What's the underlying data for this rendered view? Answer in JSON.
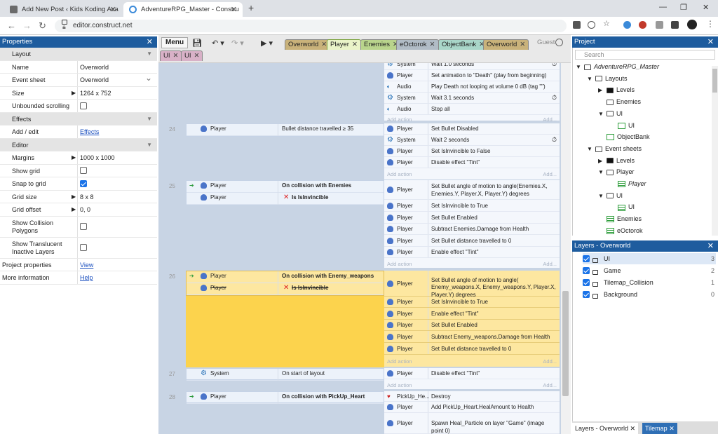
{
  "browser": {
    "tabs": [
      {
        "title": "Add New Post ‹ Kids Koding Aca",
        "active": false
      },
      {
        "title": "AdventureRPG_Master - Constru",
        "active": true
      }
    ],
    "url": "editor.construct.net"
  },
  "properties": {
    "title": "Properties",
    "rows": [
      {
        "type": "section",
        "label": "Layout"
      },
      {
        "type": "text",
        "label": "Name",
        "value": "Overworld"
      },
      {
        "type": "select",
        "label": "Event sheet",
        "value": "Overworld"
      },
      {
        "type": "expand",
        "label": "Size",
        "value": "1264 x 752"
      },
      {
        "type": "check",
        "label": "Unbounded scrolling",
        "checked": false
      },
      {
        "type": "section",
        "label": "Effects"
      },
      {
        "type": "link",
        "label": "Add / edit",
        "value": "Effects"
      },
      {
        "type": "section",
        "label": "Editor"
      },
      {
        "type": "expand",
        "label": "Margins",
        "value": "1000 x 1000"
      },
      {
        "type": "check",
        "label": "Show grid",
        "checked": false
      },
      {
        "type": "check",
        "label": "Snap to grid",
        "checked": true
      },
      {
        "type": "expand",
        "label": "Grid size",
        "value": "8 x 8"
      },
      {
        "type": "expand",
        "label": "Grid offset",
        "value": "0, 0"
      },
      {
        "type": "check2",
        "label": "Show Collision Polygons",
        "checked": false
      },
      {
        "type": "check2",
        "label": "Show Translucent Inactive Layers",
        "checked": false
      },
      {
        "type": "link0",
        "label": "Project properties",
        "value": "View"
      },
      {
        "type": "link0",
        "label": "More information",
        "value": "Help"
      }
    ]
  },
  "toolbar": {
    "menu_label": "Menu",
    "guest_label": "Guest",
    "tabs": [
      {
        "label": "Overworld",
        "color": "#c9b27a"
      },
      {
        "label": "Player",
        "color": "#d8e8a0"
      },
      {
        "label": "Enemies",
        "color": "#b9d48c"
      },
      {
        "label": "eOctorok",
        "color": "#b1bcc6"
      },
      {
        "label": "ObjectBank",
        "color": "#a9d6c9"
      },
      {
        "label": "Overworld",
        "color": "#c9b27a"
      },
      {
        "label": "UI",
        "color": "#d8b1c7"
      },
      {
        "label": "UI",
        "color": "#d8b1c7"
      }
    ]
  },
  "events": {
    "add_action": "Add action",
    "add_short": "Add...",
    "top_block": [
      {
        "obj": "System",
        "icon": "sys",
        "text": "Wait 1.0 seconds"
      },
      {
        "obj": "Player",
        "icon": "pl",
        "text": "Set animation to \"Death\" (play from beginning)"
      },
      {
        "obj": "Audio",
        "icon": "aud",
        "text": "Play Death not looping at volume 0 dB (tag \"\")"
      },
      {
        "obj": "System",
        "icon": "sys",
        "text": "Wait 3.1 seconds"
      },
      {
        "obj": "Audio",
        "icon": "aud",
        "text": "Stop all"
      }
    ],
    "e24": {
      "num": "24",
      "conds": [
        {
          "obj": "Player",
          "text": "Bullet distance travelled ≥ 35"
        }
      ],
      "acts": [
        {
          "obj": "Player",
          "text": "Set  Bullet Disabled"
        },
        {
          "obj": "System",
          "text": "Wait 2 seconds"
        },
        {
          "obj": "Player",
          "text": "Set IsInvincible to False"
        },
        {
          "obj": "Player",
          "text": "Disable effect \"Tint\""
        }
      ]
    },
    "e25": {
      "num": "25",
      "conds": [
        {
          "obj": "Player",
          "text": "On collision with  Enemies"
        },
        {
          "obj": "Player",
          "text": "Is IsInvincible"
        }
      ],
      "acts": [
        {
          "obj": "Player",
          "text": "Set  Bullet angle of motion to angle(Enemies.X, Enemies.Y, Player.X, Player.Y) degrees"
        },
        {
          "obj": "Player",
          "text": "Set IsInvincible to True"
        },
        {
          "obj": "Player",
          "text": "Set  Bullet Enabled"
        },
        {
          "obj": "Player",
          "text": "Subtract Enemies.Damage from Health"
        },
        {
          "obj": "Player",
          "text": "Set  Bullet distance travelled to 0"
        },
        {
          "obj": "Player",
          "text": "Enable effect \"Tint\""
        }
      ]
    },
    "e26": {
      "num": "26",
      "conds": [
        {
          "obj": "Player",
          "text": "On collision with  Enemy_weapons"
        },
        {
          "obj": "Player",
          "text": "Is IsInvincible"
        }
      ],
      "acts": [
        {
          "obj": "Player",
          "text": "Set  Bullet angle of motion to angle( Enemy_weapons.X, Enemy_weapons.Y, Player.X, Player.Y) degrees"
        },
        {
          "obj": "Player",
          "text": "Set IsInvincible to True"
        },
        {
          "obj": "Player",
          "text": "Enable effect \"Tint\""
        },
        {
          "obj": "Player",
          "text": "Set  Bullet Enabled"
        },
        {
          "obj": "Player",
          "text": "Subtract Enemy_weapons.Damage from Health"
        },
        {
          "obj": "Player",
          "text": "Set  Bullet distance travelled to 0"
        }
      ]
    },
    "e27": {
      "num": "27",
      "conds": [
        {
          "obj": "System",
          "text": "On start of layout"
        }
      ],
      "acts": [
        {
          "obj": "Player",
          "text": "Disable effect \"Tint\""
        }
      ]
    },
    "e28": {
      "num": "28",
      "conds": [
        {
          "obj": "Player",
          "text": "On collision with  PickUp_Heart"
        }
      ],
      "acts": [
        {
          "obj": "PickUp_He...",
          "text": "Destroy"
        },
        {
          "obj": "Player",
          "text": "Add PickUp_Heart.HealAmount to Health"
        },
        {
          "obj": "Player",
          "text": "Spawn  Heal_Particle on layer \"Game\" (image point 0)"
        }
      ]
    }
  },
  "project": {
    "title": "Project",
    "search_placeholder": "Search",
    "tree": [
      {
        "d": 0,
        "arrow": "open",
        "icon": "fold",
        "label": "AdventureRPG_Master",
        "italic": true
      },
      {
        "d": 1,
        "arrow": "open",
        "icon": "fold",
        "label": "Layouts"
      },
      {
        "d": 2,
        "arrow": "closed",
        "icon": "foldfill",
        "label": "Levels"
      },
      {
        "d": 2,
        "arrow": "none",
        "icon": "fold",
        "label": "Enemies"
      },
      {
        "d": 2,
        "arrow": "open",
        "icon": "fold",
        "label": "UI"
      },
      {
        "d": 3,
        "arrow": "none",
        "icon": "lay",
        "label": "UI"
      },
      {
        "d": 2,
        "arrow": "none",
        "icon": "lay",
        "label": "ObjectBank"
      },
      {
        "d": 1,
        "arrow": "open",
        "icon": "fold",
        "label": "Event sheets"
      },
      {
        "d": 2,
        "arrow": "closed",
        "icon": "foldfill",
        "label": "Levels"
      },
      {
        "d": 2,
        "arrow": "open",
        "icon": "fold",
        "label": "Player"
      },
      {
        "d": 3,
        "arrow": "none",
        "icon": "evs",
        "label": "Player",
        "italic": true
      },
      {
        "d": 2,
        "arrow": "open",
        "icon": "fold",
        "label": "UI"
      },
      {
        "d": 3,
        "arrow": "none",
        "icon": "evs",
        "label": "UI"
      },
      {
        "d": 2,
        "arrow": "none",
        "icon": "evs",
        "label": "Enemies"
      },
      {
        "d": 2,
        "arrow": "none",
        "icon": "evs",
        "label": "eOctorok"
      }
    ]
  },
  "layers": {
    "title": "Layers - Overworld",
    "rows": [
      {
        "name": "UI",
        "num": "3"
      },
      {
        "name": "Game",
        "num": "2"
      },
      {
        "name": "Tilemap_Collision",
        "num": "1"
      },
      {
        "name": "Background",
        "num": "0"
      }
    ]
  },
  "bottom_tabs": [
    "Layers - Overworld",
    "Tilemap"
  ]
}
